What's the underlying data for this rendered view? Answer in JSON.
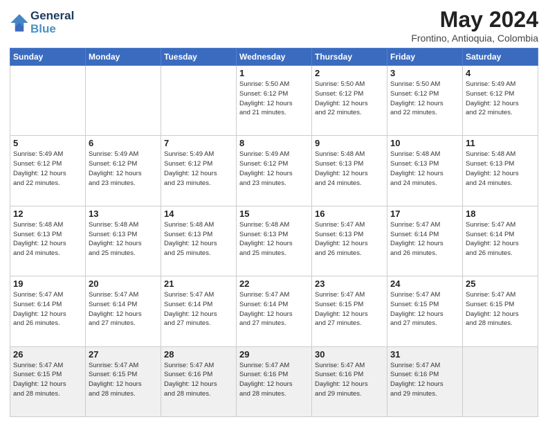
{
  "header": {
    "logo_line1": "General",
    "logo_line2": "Blue",
    "month_title": "May 2024",
    "location": "Frontino, Antioquia, Colombia"
  },
  "weekdays": [
    "Sunday",
    "Monday",
    "Tuesday",
    "Wednesday",
    "Thursday",
    "Friday",
    "Saturday"
  ],
  "weeks": [
    [
      {
        "day": "",
        "info": ""
      },
      {
        "day": "",
        "info": ""
      },
      {
        "day": "",
        "info": ""
      },
      {
        "day": "1",
        "info": "Sunrise: 5:50 AM\nSunset: 6:12 PM\nDaylight: 12 hours\nand 21 minutes."
      },
      {
        "day": "2",
        "info": "Sunrise: 5:50 AM\nSunset: 6:12 PM\nDaylight: 12 hours\nand 22 minutes."
      },
      {
        "day": "3",
        "info": "Sunrise: 5:50 AM\nSunset: 6:12 PM\nDaylight: 12 hours\nand 22 minutes."
      },
      {
        "day": "4",
        "info": "Sunrise: 5:49 AM\nSunset: 6:12 PM\nDaylight: 12 hours\nand 22 minutes."
      }
    ],
    [
      {
        "day": "5",
        "info": "Sunrise: 5:49 AM\nSunset: 6:12 PM\nDaylight: 12 hours\nand 22 minutes."
      },
      {
        "day": "6",
        "info": "Sunrise: 5:49 AM\nSunset: 6:12 PM\nDaylight: 12 hours\nand 23 minutes."
      },
      {
        "day": "7",
        "info": "Sunrise: 5:49 AM\nSunset: 6:12 PM\nDaylight: 12 hours\nand 23 minutes."
      },
      {
        "day": "8",
        "info": "Sunrise: 5:49 AM\nSunset: 6:12 PM\nDaylight: 12 hours\nand 23 minutes."
      },
      {
        "day": "9",
        "info": "Sunrise: 5:48 AM\nSunset: 6:13 PM\nDaylight: 12 hours\nand 24 minutes."
      },
      {
        "day": "10",
        "info": "Sunrise: 5:48 AM\nSunset: 6:13 PM\nDaylight: 12 hours\nand 24 minutes."
      },
      {
        "day": "11",
        "info": "Sunrise: 5:48 AM\nSunset: 6:13 PM\nDaylight: 12 hours\nand 24 minutes."
      }
    ],
    [
      {
        "day": "12",
        "info": "Sunrise: 5:48 AM\nSunset: 6:13 PM\nDaylight: 12 hours\nand 24 minutes."
      },
      {
        "day": "13",
        "info": "Sunrise: 5:48 AM\nSunset: 6:13 PM\nDaylight: 12 hours\nand 25 minutes."
      },
      {
        "day": "14",
        "info": "Sunrise: 5:48 AM\nSunset: 6:13 PM\nDaylight: 12 hours\nand 25 minutes."
      },
      {
        "day": "15",
        "info": "Sunrise: 5:48 AM\nSunset: 6:13 PM\nDaylight: 12 hours\nand 25 minutes."
      },
      {
        "day": "16",
        "info": "Sunrise: 5:47 AM\nSunset: 6:13 PM\nDaylight: 12 hours\nand 26 minutes."
      },
      {
        "day": "17",
        "info": "Sunrise: 5:47 AM\nSunset: 6:14 PM\nDaylight: 12 hours\nand 26 minutes."
      },
      {
        "day": "18",
        "info": "Sunrise: 5:47 AM\nSunset: 6:14 PM\nDaylight: 12 hours\nand 26 minutes."
      }
    ],
    [
      {
        "day": "19",
        "info": "Sunrise: 5:47 AM\nSunset: 6:14 PM\nDaylight: 12 hours\nand 26 minutes."
      },
      {
        "day": "20",
        "info": "Sunrise: 5:47 AM\nSunset: 6:14 PM\nDaylight: 12 hours\nand 27 minutes."
      },
      {
        "day": "21",
        "info": "Sunrise: 5:47 AM\nSunset: 6:14 PM\nDaylight: 12 hours\nand 27 minutes."
      },
      {
        "day": "22",
        "info": "Sunrise: 5:47 AM\nSunset: 6:14 PM\nDaylight: 12 hours\nand 27 minutes."
      },
      {
        "day": "23",
        "info": "Sunrise: 5:47 AM\nSunset: 6:15 PM\nDaylight: 12 hours\nand 27 minutes."
      },
      {
        "day": "24",
        "info": "Sunrise: 5:47 AM\nSunset: 6:15 PM\nDaylight: 12 hours\nand 27 minutes."
      },
      {
        "day": "25",
        "info": "Sunrise: 5:47 AM\nSunset: 6:15 PM\nDaylight: 12 hours\nand 28 minutes."
      }
    ],
    [
      {
        "day": "26",
        "info": "Sunrise: 5:47 AM\nSunset: 6:15 PM\nDaylight: 12 hours\nand 28 minutes."
      },
      {
        "day": "27",
        "info": "Sunrise: 5:47 AM\nSunset: 6:15 PM\nDaylight: 12 hours\nand 28 minutes."
      },
      {
        "day": "28",
        "info": "Sunrise: 5:47 AM\nSunset: 6:16 PM\nDaylight: 12 hours\nand 28 minutes."
      },
      {
        "day": "29",
        "info": "Sunrise: 5:47 AM\nSunset: 6:16 PM\nDaylight: 12 hours\nand 28 minutes."
      },
      {
        "day": "30",
        "info": "Sunrise: 5:47 AM\nSunset: 6:16 PM\nDaylight: 12 hours\nand 29 minutes."
      },
      {
        "day": "31",
        "info": "Sunrise: 5:47 AM\nSunset: 6:16 PM\nDaylight: 12 hours\nand 29 minutes."
      },
      {
        "day": "",
        "info": ""
      }
    ]
  ]
}
